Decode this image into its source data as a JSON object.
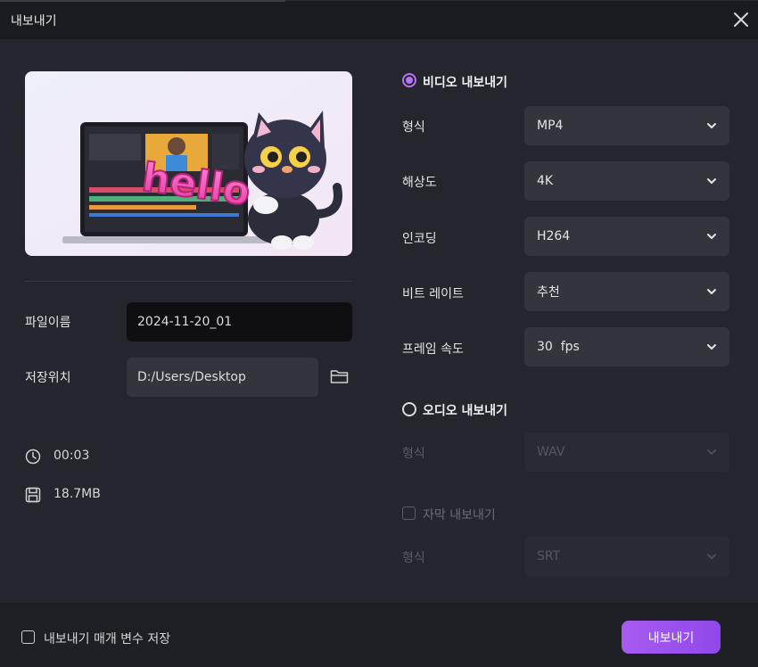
{
  "window": {
    "title": "내보내기"
  },
  "file": {
    "name_label": "파일이름",
    "name_value": "2024-11-20_01",
    "location_label": "저장위치",
    "location_value": "D:/Users/Desktop"
  },
  "info": {
    "duration": "00:03",
    "size": "18.7MB"
  },
  "video": {
    "title": "비디오 내보내기",
    "selected": true,
    "format_label": "형식",
    "format_value": "MP4",
    "resolution_label": "해상도",
    "resolution_value": "4K",
    "encoding_label": "인코딩",
    "encoding_value": "H264",
    "bitrate_label": "비트 레이트",
    "bitrate_value": "추천",
    "framerate_label": "프레임 속도",
    "framerate_value": "30  fps"
  },
  "audio": {
    "title": "오디오 내보내기",
    "selected": false,
    "format_label": "형식",
    "format_value": "WAV"
  },
  "subtitle": {
    "title": "자막 내보내기",
    "checked": false,
    "format_label": "형식",
    "format_value": "SRT"
  },
  "footer": {
    "save_params_label": "내보내기 매개 변수 저장",
    "export_label": "내보내기"
  },
  "preview": {
    "text": "hello"
  },
  "colors": {
    "accent": "#a75bf0",
    "background": "#25262d",
    "field": "#33343c"
  }
}
